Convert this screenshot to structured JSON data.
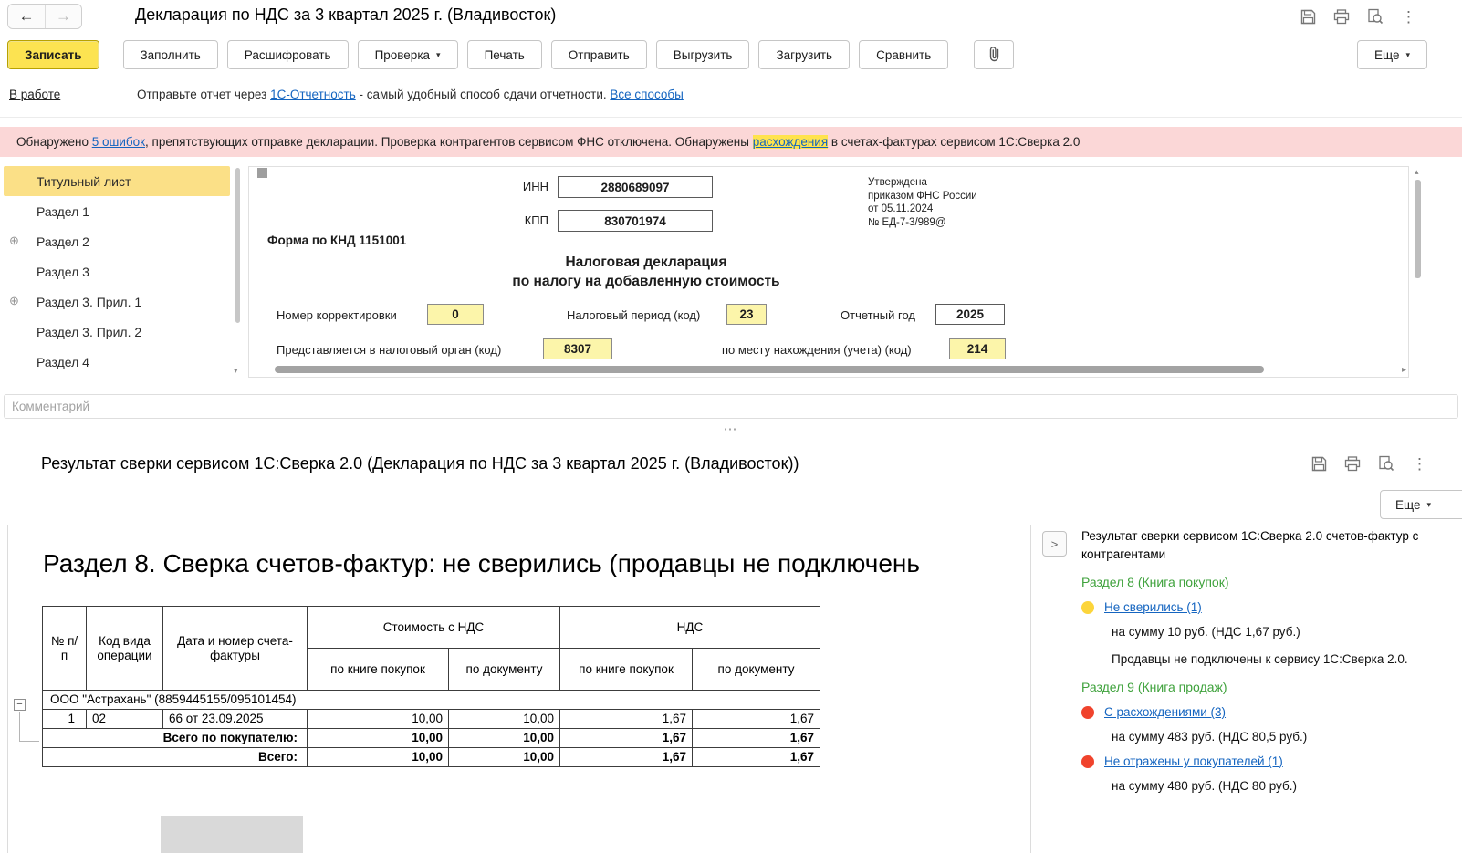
{
  "colors": {
    "link": "#1565c0",
    "green": "#3fa23c",
    "selected_tab": "#fbe087",
    "primary_btn_bg": "#fce351",
    "primary_btn_border": "#b8a200",
    "error_bg": "#fbd7d7",
    "highlight": "#ffe34d",
    "dot_yellow": "#fcd53b",
    "dot_red": "#f0432c",
    "field_yellow": "#fcf5aa"
  },
  "glyphs": {
    "back_arrow": "←",
    "forward_arrow": "→",
    "caret_down": "▾",
    "more_vertical": "⋮",
    "splitter_dots": "⋯",
    "expander_plus": "⊕",
    "collapse_minus": "−",
    "chevron_right": ">",
    "scroll_down": "▾",
    "scroll_up": "▴",
    "scroll_right": "▸"
  },
  "top": {
    "title": "Декларация по НДС за 3 квартал 2025 г. (Владивосток)",
    "toolbar": {
      "save": "Записать",
      "fill": "Заполнить",
      "decipher": "Расшифровать",
      "check": "Проверка",
      "print": "Печать",
      "send": "Отправить",
      "upload": "Выгрузить",
      "download": "Загрузить",
      "compare": "Сравнить",
      "more": "Еще"
    },
    "status": {
      "state": "В работе",
      "text1": "Отправьте отчет через ",
      "link1": "1С-Отчетность",
      "text2": " - самый удобный способ сдачи отчетности. ",
      "link2": "Все способы"
    },
    "error": {
      "text1": "Обнаружено ",
      "link1": "5 ошибок",
      "text2": ", препятствующих отправке декларации. Проверка контрагентов сервисом ФНС отключена. Обнаружены ",
      "link2": "расхождения",
      "text3": " в счетах-фактурах сервисом 1С:Сверка 2.0"
    },
    "sidebar": {
      "items": [
        {
          "label": "Титульный лист",
          "selected": true
        },
        {
          "label": "Раздел 1"
        },
        {
          "label": "Раздел 2",
          "expandable": true
        },
        {
          "label": "Раздел 3"
        },
        {
          "label": "Раздел 3. Прил. 1",
          "expandable": true
        },
        {
          "label": "Раздел 3. Прил. 2"
        },
        {
          "label": "Раздел 4"
        }
      ]
    },
    "form": {
      "inn_label": "ИНН",
      "inn": "2880689097",
      "kpp_label": "КПП",
      "kpp": "830701974",
      "knd": "Форма по КНД 1151001",
      "approved_line1": "Утверждена",
      "approved_line2": "приказом ФНС России",
      "approved_line3": "от 05.11.2024",
      "approved_line4": "№ ЕД-7-3/989@",
      "title_line1": "Налоговая декларация",
      "title_line2": "по налогу на добавленную стоимость",
      "correction_label": "Номер корректировки",
      "correction": "0",
      "period_label": "Налоговый период (код)",
      "period": "23",
      "year_label": "Отчетный год",
      "year": "2025",
      "authority_label": "Представляется в налоговый орган (код)",
      "authority": "8307",
      "location_label": "по месту нахождения (учета) (код)",
      "location": "214"
    },
    "comment_placeholder": "Комментарий"
  },
  "bottom": {
    "title": "Результат сверки сервисом 1С:Сверка 2.0 (Декларация по НДС за 3 квартал 2025 г. (Владивосток))",
    "more": "Еще",
    "report": {
      "heading": "Раздел 8. Сверка счетов-фактур: не сверились (продавцы не подключень",
      "table": {
        "col_num": "№ п/п",
        "col_opcode": "Код вида операции",
        "col_invoice": "Дата и номер счета-фактуры",
        "col_cost": "Стоимость с НДС",
        "col_vat": "НДС",
        "col_by_book": "по книге покупок",
        "col_by_doc": "по документу",
        "group": "ООО \"Астрахань\" (8859445155/095101454)",
        "row": {
          "num": "1",
          "opcode": "02",
          "invoice": "66 от 23.09.2025",
          "cost_book": "10,00",
          "cost_doc": "10,00",
          "vat_book": "1,67",
          "vat_doc": "1,67"
        },
        "total_buyer_label": "Всего по покупателю:",
        "total_buyer": [
          "10,00",
          "10,00",
          "1,67",
          "1,67"
        ],
        "total_label": "Всего:",
        "total": [
          "10,00",
          "10,00",
          "1,67",
          "1,67"
        ]
      }
    },
    "panel": {
      "header": "Результат сверки сервисом 1С:Сверка 2.0 счетов-фактур с контрагентами",
      "section8_title": "Раздел 8 (Книга покупок)",
      "item1_link": "Не сверились (1)",
      "item1_sum": "на сумму 10 руб. (НДС 1,67 руб.)",
      "item1_note": "Продавцы не подключены к сервису 1С:Сверка 2.0.",
      "section9_title": "Раздел 9 (Книга продаж)",
      "item2_link": "С расхождениями (3)",
      "item2_sum": "на сумму 483 руб. (НДС 80,5 руб.)",
      "item3_link": "Не отражены у покупателей (1)",
      "item3_sum": "на сумму 480 руб. (НДС 80 руб.)"
    }
  }
}
